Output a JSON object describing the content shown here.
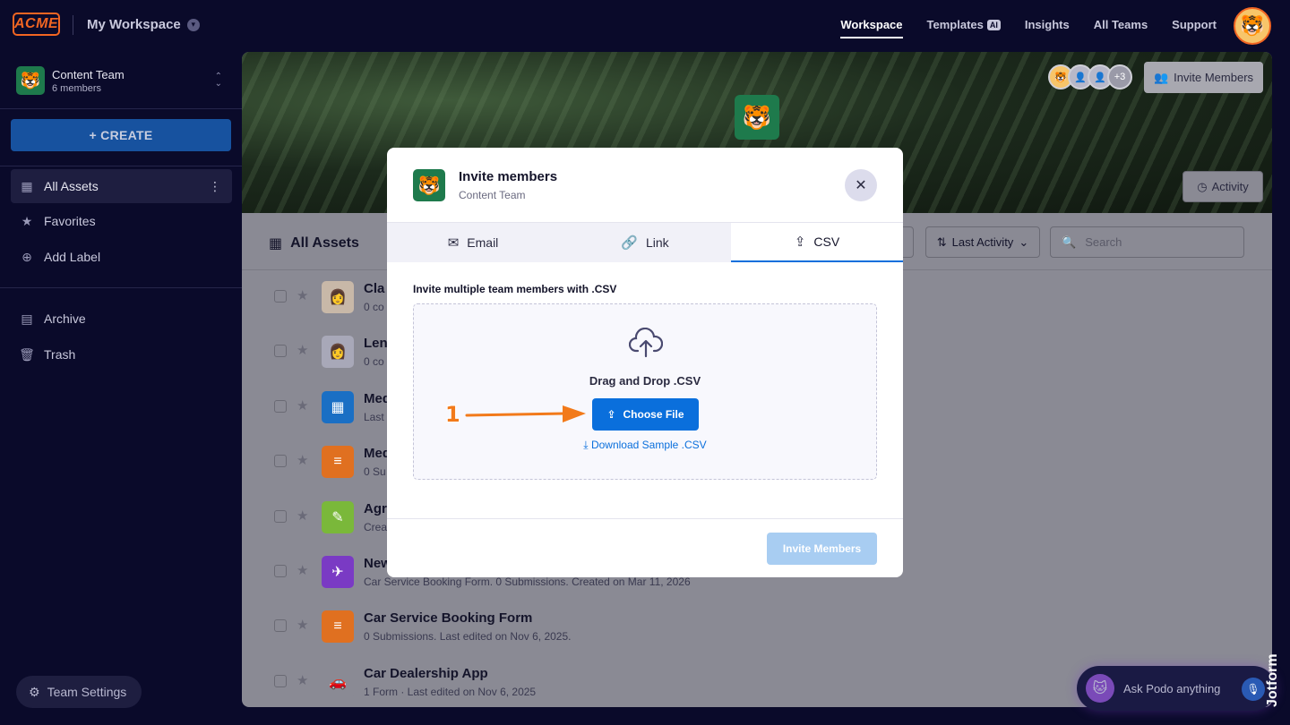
{
  "header": {
    "logo": "ACME",
    "workspace": "My Workspace",
    "nav": [
      {
        "label": "Workspace"
      },
      {
        "label": "Templates",
        "badge": "AI"
      },
      {
        "label": "Insights"
      },
      {
        "label": "All Teams"
      },
      {
        "label": "Support"
      }
    ]
  },
  "sidebar": {
    "team_name": "Content Team",
    "team_members": "6 members",
    "create_label": "+ CREATE",
    "items": [
      {
        "label": "All Assets",
        "icon": "grid-icon"
      },
      {
        "label": "Favorites",
        "icon": "star-icon"
      },
      {
        "label": "Add Label",
        "icon": "plus-circle-icon"
      },
      {
        "label": "Archive",
        "icon": "archive-icon"
      },
      {
        "label": "Trash",
        "icon": "trash-icon"
      }
    ],
    "team_settings": "Team Settings"
  },
  "banner": {
    "member_count_extra": "+3",
    "invite_label": "Invite Members",
    "activity_label": "Activity"
  },
  "toolbar": {
    "title": "All Assets",
    "sort_label": "Last Activity",
    "search_placeholder": "Search"
  },
  "assets": [
    {
      "title": "Cla",
      "sub": "0 co",
      "color": "#c8b8a8"
    },
    {
      "title": "Len",
      "sub": "0 co",
      "color": "#a8a8b8"
    },
    {
      "title": "Med",
      "sub": "Last",
      "color": "#1a6fc4"
    },
    {
      "title": "Med",
      "sub": "0 Su",
      "color": "#e07020"
    },
    {
      "title": "Agr",
      "sub": "Crea",
      "color": "#7ab83a"
    },
    {
      "title": "New",
      "sub": "Car Service Booking Form. 0 Submissions. Created on Mar 11, 2026",
      "color": "#7a3ac4"
    },
    {
      "title": "Car Service Booking Form",
      "sub": "0 Submissions.  Last edited on Nov 6, 2025.",
      "color": "#e07020"
    },
    {
      "title": "Car Dealership App",
      "sub": "1 Form · Last edited on Nov 6, 2025",
      "color": "#8a8a94"
    }
  ],
  "modal": {
    "title": "Invite members",
    "subtitle": "Content Team",
    "tabs": [
      {
        "label": "Email",
        "icon": "envelope-icon"
      },
      {
        "label": "Link",
        "icon": "link-icon"
      },
      {
        "label": "CSV",
        "icon": "upload-icon"
      }
    ],
    "active_tab": 2,
    "csv_heading": "Invite multiple team members with .CSV",
    "drag_text": "Drag and Drop .CSV",
    "choose_label": "Choose File",
    "sample_label": "Download Sample .CSV",
    "invite_label": "Invite Members"
  },
  "annotation": {
    "step": "1"
  },
  "podo": {
    "placeholder": "Ask Podo anything"
  },
  "watermark": "Jotform",
  "colors": {
    "accent": "#0a6fdc",
    "orange": "#f27a1a",
    "team_green": "#1e7a4c"
  }
}
